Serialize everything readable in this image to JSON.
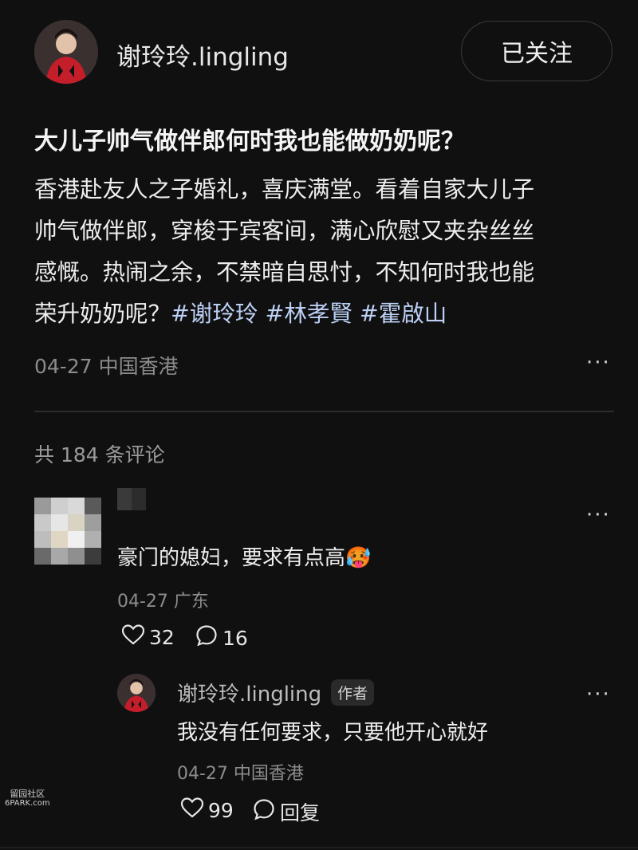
{
  "post": {
    "author_name": "谢玲玲.lingling",
    "follow_label": "已关注",
    "title": "大儿子帅气做伴郎何时我也能做奶奶呢？",
    "body_lines": [
      "香港赴友人之子婚礼，喜庆满堂。看着自家大儿子",
      "帅气做伴郎，穿梭于宾客间，满心欣慰又夹杂丝丝",
      "感慨。热闹之余，不禁暗自思忖，不知何时我也能"
    ],
    "body_last_prefix": "荣升奶奶呢？",
    "hashtags": [
      "#谢玲玲",
      "#林孝賢",
      "#霍啟山"
    ],
    "date_location": "04-27 中国香港",
    "more_label": "···"
  },
  "comments_header": {
    "count_label": "共 184 条评论"
  },
  "comment": {
    "text": "豪门的媳妇，要求有点高🥵",
    "date_location": "04-27 广东",
    "likes": "32",
    "replies": "16",
    "more_label": "···"
  },
  "reply": {
    "author_name": "谢玲玲.lingling",
    "author_badge": "作者",
    "text": "我没有任何要求，只要他开心就好",
    "date_location": "04-27 中国香港",
    "likes": "99",
    "reply_label": "回复",
    "more_label": "···"
  },
  "watermark": {
    "line1": "留园社区",
    "line2": "6PARK.com"
  },
  "colors": {
    "background": "#101010",
    "hashtag": "#bcd0f5",
    "muted": "#8c8c8c"
  },
  "icons": {
    "like": "heart-outline-icon",
    "comment": "speech-bubble-icon",
    "more": "ellipsis-icon"
  }
}
